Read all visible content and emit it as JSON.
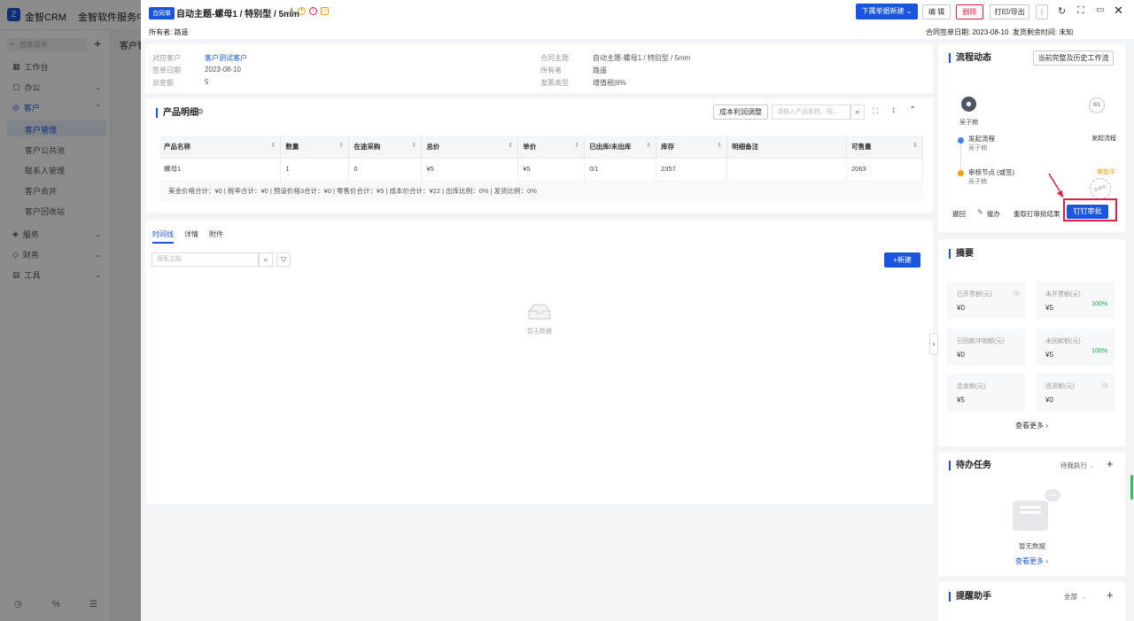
{
  "app": {
    "name": "金智CRM",
    "tab": "金智软件服务中心",
    "bg_title": "客户管",
    "search_placeholder": "搜索菜单"
  },
  "sidebar": {
    "items": [
      {
        "label": "工作台"
      },
      {
        "label": "办公",
        "chev": "⌄"
      },
      {
        "label": "客户",
        "chev": "⌃"
      },
      {
        "label": "服务",
        "chev": "⌄"
      },
      {
        "label": "财务",
        "chev": "⌄"
      },
      {
        "label": "工具",
        "chev": "⌄"
      }
    ],
    "sub_items": [
      {
        "label": "客户管理"
      },
      {
        "label": "客户公共池"
      },
      {
        "label": "联系人管理"
      },
      {
        "label": "客户合并"
      },
      {
        "label": "客户回收站"
      }
    ]
  },
  "header": {
    "badge": "合同单",
    "title": "自动主题-螺母1 / 特别型 / 5mm",
    "owner_label": "所有者:",
    "owner": "路遥",
    "sign_date_label": "合同签单日期:",
    "sign_date": "2023-08-10",
    "ship_label": "发货剩余时间:",
    "ship_value": "未知",
    "btn_new": "下属单据新建",
    "btn_edit": "编 辑",
    "btn_delete": "删除",
    "btn_print": "打印/导出"
  },
  "info": {
    "rows_left": [
      {
        "label": "对应客户",
        "value": "客户测试客户"
      },
      {
        "label": "签单日期",
        "value": "2023-08-10"
      },
      {
        "label": "总金额",
        "value": "5"
      }
    ],
    "rows_right": [
      {
        "label": "合同主题",
        "value": "自动主题-螺母1 / 特别型 / 5mm"
      },
      {
        "label": "所有者",
        "value": "路遥"
      },
      {
        "label": "发票类型",
        "value": "增值税|6%"
      }
    ]
  },
  "products": {
    "title": "产品明细",
    "btn_cost": "成本利润调整",
    "search_placeholder": "请输入产品名称、规...",
    "columns": [
      "产品名称",
      "数量",
      "在途采购",
      "总价",
      "单价",
      "已出库/未出库",
      "库存",
      "明细备注",
      "可售量"
    ],
    "rows": [
      [
        "螺母1",
        "1",
        "0",
        "¥5",
        "¥5",
        "0/1",
        "2357",
        "",
        "2063"
      ]
    ],
    "totals": "美金价格合计：¥0 |  税率合计：¥0 |  预设价格3合计：¥0 |  零售价合计：¥5 |  成本价合计：¥22 |  出库比例：0% |  发货比例：0%"
  },
  "timeline": {
    "tabs": [
      "时间线",
      "详情",
      "附件"
    ],
    "search_placeholder": "搜索主题",
    "btn_new": "+新建",
    "empty": "暂无数据"
  },
  "workflow": {
    "title": "流程动态",
    "btn_history": "当前完整及历史工作流",
    "user": "吴子楠",
    "count": "0/1",
    "steps": [
      {
        "name": "发起流程",
        "user": "吴子楠",
        "status": "发起流程"
      },
      {
        "name": "审核节点 (或签)",
        "user": "吴子楠",
        "status": "审批中"
      }
    ],
    "stamp": "未审批",
    "actions": [
      "撤回",
      "催办",
      "重取钉审批结果"
    ],
    "btn_ding": "钉钉审批"
  },
  "summary": {
    "title": "摘要",
    "cells": [
      {
        "label": "已开票额(元)",
        "value": "¥0",
        "pct": ""
      },
      {
        "label": "未开票额(元)",
        "value": "¥5",
        "pct": "100%"
      },
      {
        "label": "已回款冲销额(元)",
        "value": "¥0",
        "pct": ""
      },
      {
        "label": "未回款额(元)",
        "value": "¥5",
        "pct": "100%"
      },
      {
        "label": "总金额(元)",
        "value": "¥5",
        "pct": ""
      },
      {
        "label": "退货额(元)",
        "value": "¥0",
        "pct": ""
      }
    ],
    "more": "查看更多"
  },
  "tasks": {
    "title": "待办任务",
    "filter": "待我执行",
    "empty": "暂无数据",
    "more": "查看更多"
  },
  "reminder": {
    "title": "提醒助手",
    "filter": "全部"
  },
  "colors": {
    "accent": "#1a56db",
    "danger": "#e11d48",
    "success": "#16a34a",
    "warning": "#f59e0b"
  }
}
